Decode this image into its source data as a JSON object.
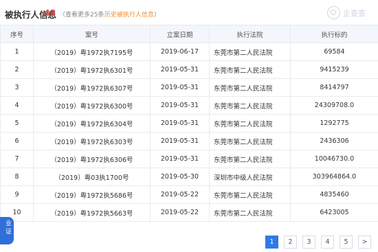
{
  "header": {
    "title": "被执行人信息",
    "count": "43",
    "hint": "（查看更多25条",
    "history_link": "历史被执行人信息",
    "hint_close": "）",
    "logo_text": "企查查"
  },
  "table": {
    "columns": [
      "序号",
      "案号",
      "立案日期",
      "执行法院",
      "执行标的"
    ],
    "rows": [
      {
        "no": "1",
        "case": "（2019）粤1972执7195号",
        "date": "2019-06-17",
        "court": "东莞市第二人民法院",
        "amount": "69584"
      },
      {
        "no": "2",
        "case": "（2019）粤1972执6301号",
        "date": "2019-05-31",
        "court": "东莞市第二人民法院",
        "amount": "9415239"
      },
      {
        "no": "3",
        "case": "（2019）粤1972执6307号",
        "date": "2019-05-31",
        "court": "东莞市第二人民法院",
        "amount": "8414797"
      },
      {
        "no": "4",
        "case": "（2019）粤1972执6300号",
        "date": "2019-05-31",
        "court": "东莞市第二人民法院",
        "amount": "24309708.0"
      },
      {
        "no": "5",
        "case": "（2019）粤1972执6304号",
        "date": "2019-05-31",
        "court": "东莞市第二人民法院",
        "amount": "1292775"
      },
      {
        "no": "6",
        "case": "（2019）粤1972执6303号",
        "date": "2019-05-31",
        "court": "东莞市第二人民法院",
        "amount": "2436306"
      },
      {
        "no": "7",
        "case": "（2019）粤1972执6306号",
        "date": "2019-05-31",
        "court": "东莞市第二人民法院",
        "amount": "10046730.0"
      },
      {
        "no": "8",
        "case": "（2019）粤03执1700号",
        "date": "2019-05-30",
        "court": "深圳市中级人民法院",
        "amount": "303964864.0"
      },
      {
        "no": "9",
        "case": "（2019）粤1972执5686号",
        "date": "2019-05-22",
        "court": "东莞市第二人民法院",
        "amount": "4835460"
      },
      {
        "no": "10",
        "case": "（2019）粤1972执5663号",
        "date": "2019-05-22",
        "court": "东莞市第二人民法院",
        "amount": "6423005"
      }
    ]
  },
  "pagination": {
    "pages": [
      "1",
      "2",
      "3",
      "4",
      "5"
    ],
    "next": ">",
    "current": "1"
  },
  "badge": {
    "line1": "业",
    "line2": "证"
  },
  "colors": {
    "accent": "#2f7be6",
    "count_red": "#e14c4c",
    "link_orange": "#f08c2a",
    "case_blue": "#3a7cc9",
    "header_bg": "#f3f6fa"
  }
}
